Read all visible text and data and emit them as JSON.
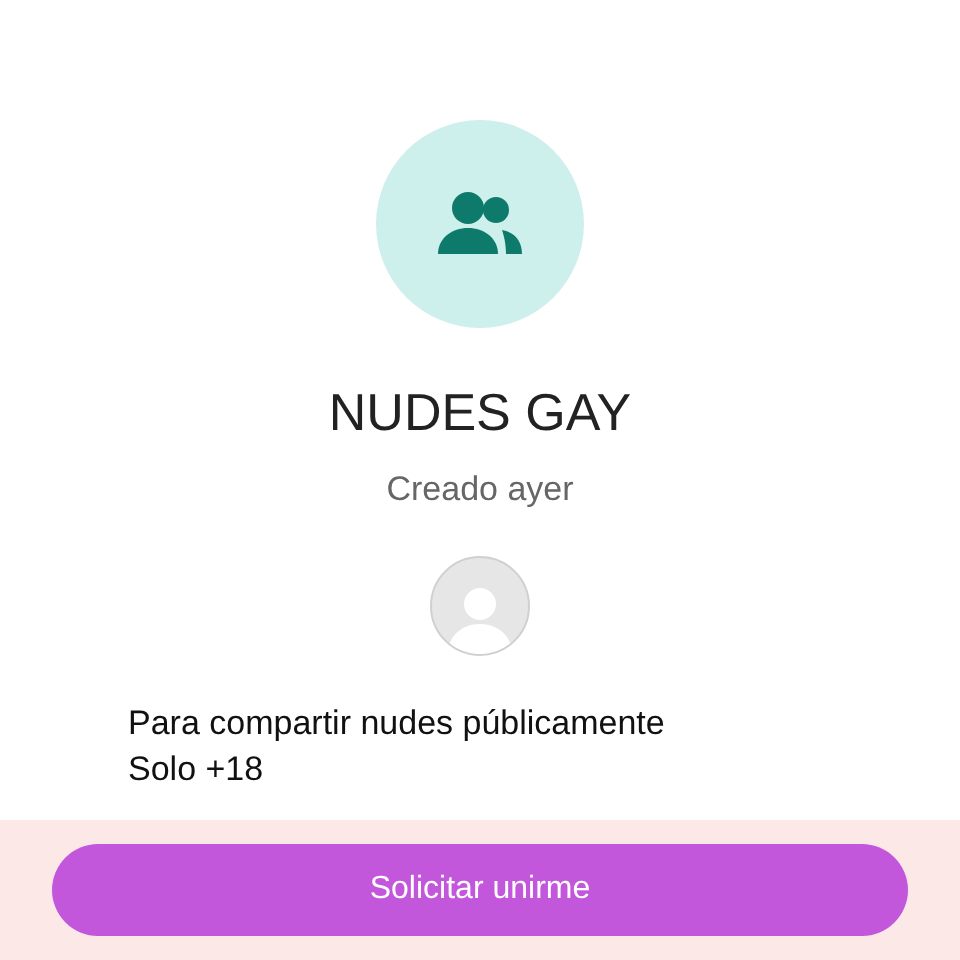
{
  "group": {
    "name": "NUDES GAY",
    "created": "Creado ayer"
  },
  "description": [
    "Para compartir nudes públicamente",
    "Solo +18"
  ],
  "button": {
    "label": "Solicitar unirme"
  }
}
